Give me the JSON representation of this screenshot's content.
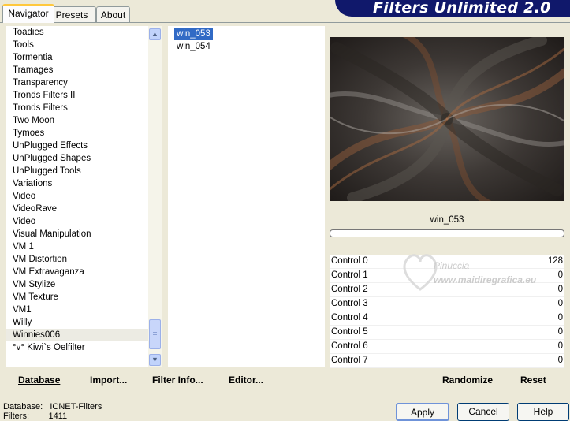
{
  "tabs": [
    {
      "label": "Navigator"
    },
    {
      "label": "Presets"
    },
    {
      "label": "About"
    }
  ],
  "banner": {
    "title": "Filters Unlimited 2.0"
  },
  "categories": {
    "items": [
      "Toadies",
      "Tools",
      "Tormentia",
      "Tramages",
      "Transparency",
      "Tronds Filters II",
      "Tronds Filters",
      "Two Moon",
      "Tymoes",
      "UnPlugged Effects",
      "UnPlugged Shapes",
      "UnPlugged Tools",
      "Variations",
      "Video",
      "VideoRave",
      "Video",
      "Visual Manipulation",
      "VM 1",
      "VM Distortion",
      "VM Extravaganza",
      "VM Stylize",
      "VM Texture",
      "VM1",
      "Willy",
      "Winnies006",
      "°v° Kiwi`s Oelfilter"
    ],
    "selected": "Winnies006"
  },
  "filters": {
    "items": [
      "win_053",
      "win_054"
    ],
    "selected": "win_053"
  },
  "left_buttons": {
    "database": "Database",
    "import": "Import...",
    "filter_info": "Filter Info...",
    "editor": "Editor..."
  },
  "preview": {
    "name": "win_053"
  },
  "controls": [
    {
      "label": "Control 0",
      "value": "128"
    },
    {
      "label": "Control 1",
      "value": "0"
    },
    {
      "label": "Control 2",
      "value": "0"
    },
    {
      "label": "Control 3",
      "value": "0"
    },
    {
      "label": "Control 4",
      "value": "0"
    },
    {
      "label": "Control 5",
      "value": "0"
    },
    {
      "label": "Control 6",
      "value": "0"
    },
    {
      "label": "Control 7",
      "value": "0"
    }
  ],
  "right_buttons": {
    "randomize": "Randomize",
    "reset": "Reset"
  },
  "status": {
    "database_label": "Database:",
    "database_value": "ICNET-Filters",
    "filters_label": "Filters:",
    "filters_value": "1411"
  },
  "dialog_buttons": {
    "apply": "Apply",
    "cancel": "Cancel",
    "help": "Help"
  },
  "watermark": {
    "text1": "Pinuccia",
    "text2": "www.maidiregrafica.eu"
  },
  "colors": {
    "accent": "#10186b",
    "selection": "#316ac5",
    "tab_highlight": "#ffc83c"
  }
}
